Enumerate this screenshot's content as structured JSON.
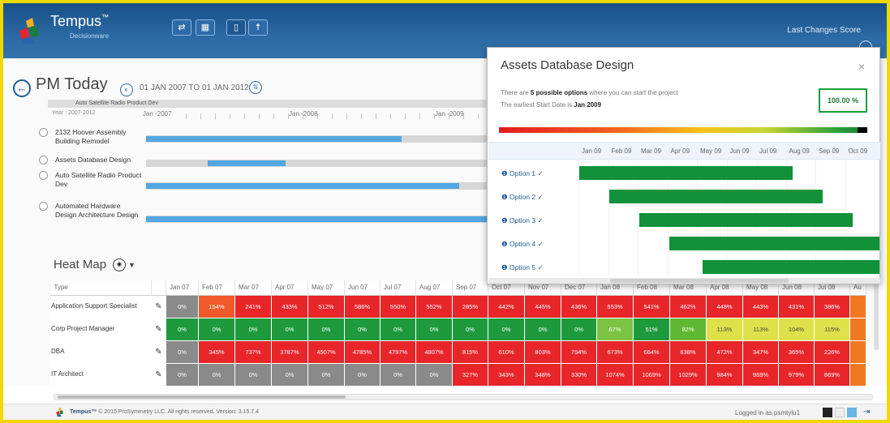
{
  "app": {
    "brand": "Tempus",
    "brand_tm": "™",
    "brand_sub": "Decisionware"
  },
  "toolbar": {
    "icons": [
      "shuffle-icon",
      "grid-icon",
      "document-icon",
      "people-icon"
    ]
  },
  "topright": {
    "last_changes": "Last Changes",
    "score": "Score"
  },
  "project": {
    "title": "PM Today",
    "date_range": "01 JAN 2007 TO 01 JAN 2012",
    "strip_label": "Auto Satellite Radio Product Dev",
    "year_label": "Year : 2007-2012",
    "timeline": [
      "Jan -2007",
      "Jan -2008",
      "Jan -2009"
    ]
  },
  "tasks": [
    {
      "label": "2132 Hoover Assembly Building Remodel",
      "bar_start": 0.0,
      "bar_end": 0.75
    },
    {
      "label": "Assets Database Design",
      "bar_start": 0.18,
      "bar_end": 0.41
    },
    {
      "label": "Auto Satellite Radio Product Dev",
      "bar_start": 0.0,
      "bar_end": 0.92
    },
    {
      "label": "Automated Hardware Design Architecture Design",
      "bar_start": 0.0,
      "bar_end": 1.0
    }
  ],
  "heatmap": {
    "title": "Heat Map",
    "type_header": "Type",
    "months": [
      "Jan 07",
      "Feb 07",
      "Mar 07",
      "Apr 07",
      "May 07",
      "Jun 07",
      "Jul 07",
      "Aug 07",
      "Sep 07",
      "Oct 07",
      "Nov 07",
      "Dec 07",
      "Jan 08",
      "Feb 08",
      "Mar 08",
      "Apr 08",
      "May 08",
      "Jun 08",
      "Jul 08",
      "Au"
    ],
    "rows": [
      {
        "type": "Application Support Specialist",
        "values": [
          "0%",
          "154%",
          "241%",
          "433%",
          "512%",
          "586%",
          "550%",
          "552%",
          "285%",
          "442%",
          "445%",
          "436%",
          "553%",
          "541%",
          "462%",
          "448%",
          "443%",
          "431%",
          "386%",
          ""
        ]
      },
      {
        "type": "Corp Project Manager",
        "values": [
          "0%",
          "0%",
          "0%",
          "0%",
          "0%",
          "0%",
          "0%",
          "0%",
          "0%",
          "0%",
          "0%",
          "0%",
          "67%",
          "51%",
          "82%",
          "113%",
          "113%",
          "104%",
          "115%",
          ""
        ]
      },
      {
        "type": "DBA",
        "values": [
          "0%",
          "345%",
          "737%",
          "3787%",
          "4507%",
          "4785%",
          "4797%",
          "4807%",
          "815%",
          "610%",
          "803%",
          "794%",
          "673%",
          "664%",
          "638%",
          "472%",
          "347%",
          "365%",
          "226%",
          ""
        ]
      },
      {
        "type": "IT Architect",
        "values": [
          "0%",
          "0%",
          "0%",
          "0%",
          "0%",
          "0%",
          "0%",
          "0%",
          "327%",
          "343%",
          "348%",
          "330%",
          "1074%",
          "1069%",
          "1029%",
          "984%",
          "969%",
          "979%",
          "869%",
          ""
        ]
      }
    ]
  },
  "panel": {
    "title": "Assets Database Design",
    "close": "×",
    "desc1_pre": "There are ",
    "desc1_bold": "5 possible options",
    "desc1_post": " where you can start the project",
    "desc2_pre": "The earliest Start Date is ",
    "desc2_bold": "Jan 2009",
    "score": "100.00 %",
    "months": [
      "Jan 09",
      "Feb 09",
      "Mar 09",
      "Apr 09",
      "May 09",
      "Jun 09",
      "Jul 09",
      "Aug 09",
      "Sep 09",
      "Oct 09"
    ],
    "options": [
      {
        "label": "Option 1",
        "start": 0.0,
        "end": 0.71
      },
      {
        "label": "Option 2",
        "start": 0.1,
        "end": 0.81
      },
      {
        "label": "Option 3",
        "start": 0.2,
        "end": 0.91
      },
      {
        "label": "Option 4",
        "start": 0.3,
        "end": 1.0
      },
      {
        "label": "Option 5",
        "start": 0.41,
        "end": 1.0
      }
    ]
  },
  "footer": {
    "brand": "Tempus™",
    "copyright": "© 2015 ProSymmetry LLC. All rights reserved. Version: 3.15.7.4",
    "logged": "Logged in as psmtylu1"
  },
  "colors": {
    "red": "#e8262a",
    "orange": "#f05a2a",
    "green": "#1e9a3c",
    "lightgreen": "#7cc243",
    "yellow": "#dfe14a",
    "gray": "#8a8a8a"
  }
}
